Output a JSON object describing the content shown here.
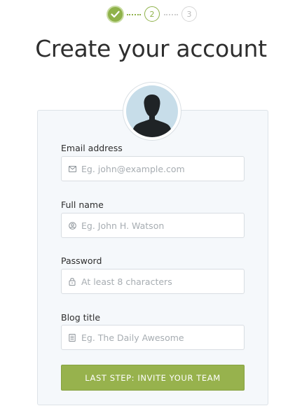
{
  "stepper": {
    "steps": [
      {
        "label": "",
        "state": "complete"
      },
      {
        "label": "2",
        "state": "current"
      },
      {
        "label": "3",
        "state": "upcoming"
      }
    ]
  },
  "page": {
    "title": "Create your account"
  },
  "form": {
    "email": {
      "label": "Email address",
      "placeholder": "Eg. john@example.com",
      "value": "",
      "icon": "envelope-icon"
    },
    "fullname": {
      "label": "Full name",
      "placeholder": "Eg. John H. Watson",
      "value": "",
      "icon": "user-icon"
    },
    "password": {
      "label": "Password",
      "placeholder": "At least 8 characters",
      "value": "",
      "icon": "lock-icon"
    },
    "blog": {
      "label": "Blog title",
      "placeholder": "Eg. The Daily Awesome",
      "value": "",
      "icon": "document-icon"
    },
    "submit_label": "LAST STEP: INVITE YOUR TEAM"
  },
  "colors": {
    "accent": "#97b24d",
    "card_bg": "#f5f8fb",
    "avatar_bg": "#c7dde9"
  }
}
